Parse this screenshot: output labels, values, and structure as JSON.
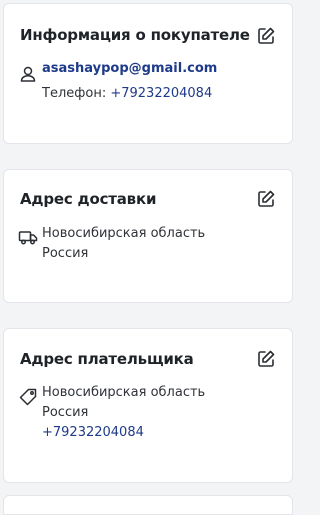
{
  "buyer": {
    "title": "Информация о покупателе",
    "email": "asashaypop@gmail.com",
    "phone_label": "Телефон:",
    "phone": "+79232204084"
  },
  "delivery": {
    "title": "Адрес доставки",
    "region": "Новосибирская область",
    "country": "Россия"
  },
  "payer": {
    "title": "Адрес плательщика",
    "region": "Новосибирская область",
    "country": "Россия",
    "phone": "+79232204084"
  },
  "icons": {
    "edit": "pencil-square-icon",
    "user": "user-icon",
    "truck": "truck-icon",
    "tag": "tag-icon"
  },
  "colors": {
    "link": "#1e3a8a",
    "background": "#f3f4f6",
    "card": "#ffffff",
    "border": "#e3e5ea"
  }
}
